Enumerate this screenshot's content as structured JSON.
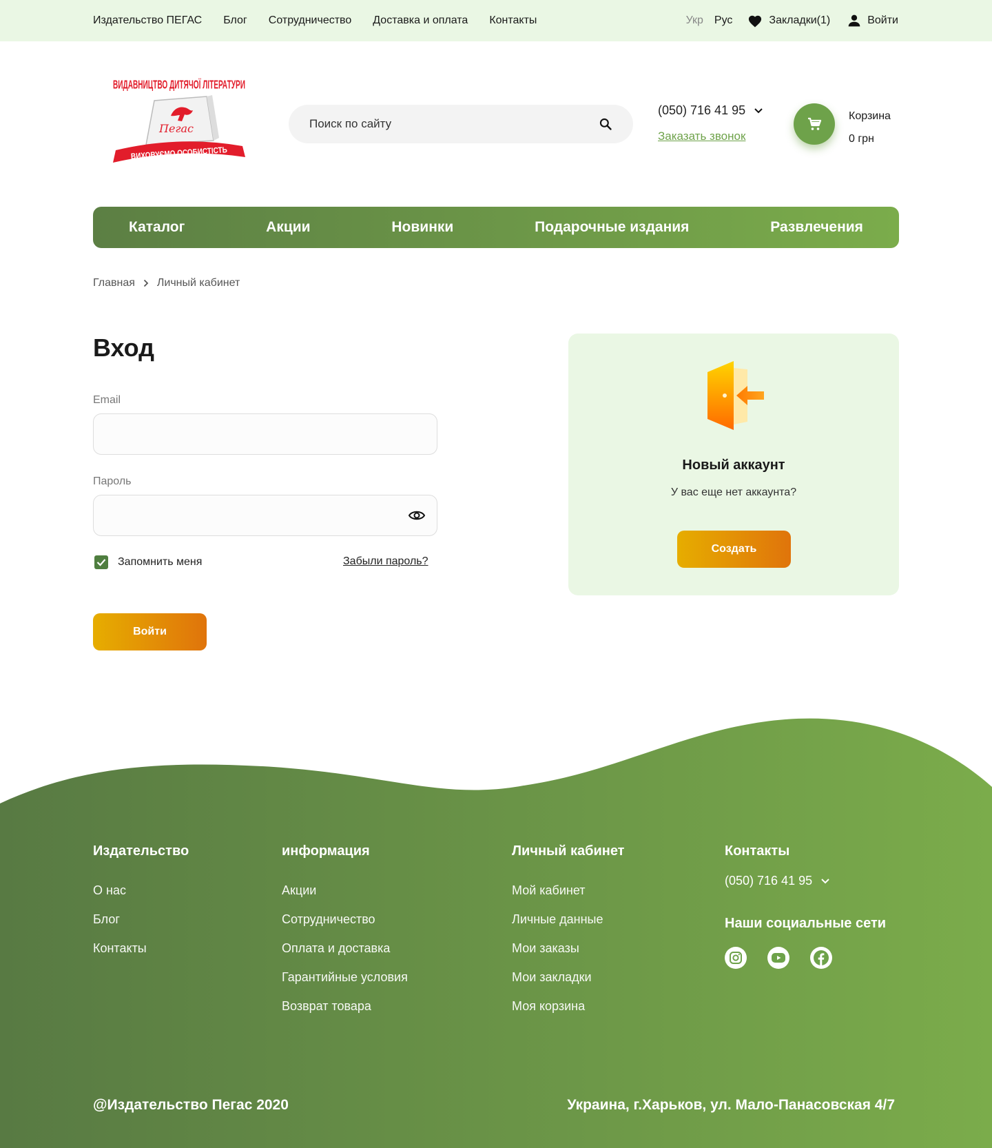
{
  "topbar": {
    "nav": [
      "Издательство ПЕГАС",
      "Блог",
      "Сотрудничество",
      "Доставка и оплата",
      "Контакты"
    ],
    "lang_ukr": "Укр",
    "lang_rus": "Рус",
    "bookmarks": "Закладки(1)",
    "login": "Войти"
  },
  "logo": {
    "top_text": "ВИДАВНИЦТВО ДИТЯЧОЇ ЛІТЕРАТУРИ",
    "brand": "Пегас",
    "ribbon": "ВИХОВУЄМО ОСОБИСТІСТЬ"
  },
  "header": {
    "search_placeholder": "Поиск по сайту",
    "phone": "(050) 716 41 95",
    "callback": "Заказать звонок",
    "cart_label": "Корзина",
    "cart_sum": "0 грн"
  },
  "mainnav": [
    "Каталог",
    "Акции",
    "Новинки",
    "Подарочные издания",
    "Развлечения"
  ],
  "breadcrumb": [
    "Главная",
    "Личный кабинет"
  ],
  "login": {
    "title": "Вход",
    "email_label": "Email",
    "password_label": "Пароль",
    "remember": "Запомнить меня",
    "remember_checked": true,
    "forgot": "Забыли пароль?",
    "submit": "Войти"
  },
  "new_account": {
    "title": "Новый аккаунт",
    "subtitle": "У вас еще нет аккаунта?",
    "button": "Создать"
  },
  "footer": {
    "col1": {
      "title": "Издательство",
      "links": [
        "О нас",
        "Блог",
        "Контакты"
      ]
    },
    "col2": {
      "title": "информация",
      "links": [
        "Акции",
        "Сотрудничество",
        "Оплата и доставка",
        "Гарантийные условия",
        "Возврат товара"
      ]
    },
    "col3": {
      "title": "Личный кабинет",
      "links": [
        "Мой кабинет",
        "Личные данные",
        "Мои заказы",
        "Мои закладки",
        "Моя корзина"
      ]
    },
    "col4": {
      "title": "Контакты",
      "phone": "(050) 716 41 95",
      "social_title": "Наши социальные сети",
      "social": [
        "instagram-icon",
        "youtube-icon",
        "facebook-icon"
      ]
    },
    "copyright": "@Издательство Пегас 2020",
    "address": "Украина,  г.Харьков, ул. Мало-Панасовская 4/7"
  },
  "colors": {
    "accent_green": "#6ea24a",
    "light_green": "#eaf7e4",
    "button_orange": "#e6ad00"
  }
}
